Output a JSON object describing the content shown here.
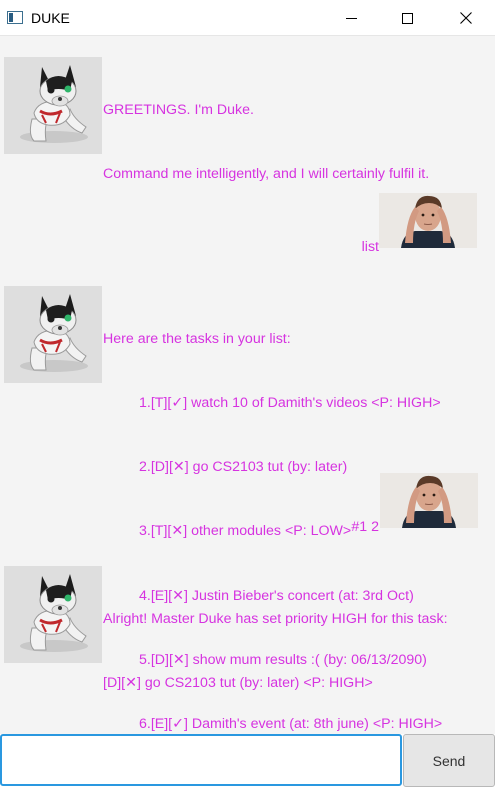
{
  "window": {
    "title": "DUKE",
    "icons": {
      "app": "app-window-icon",
      "minimize": "minimize-icon",
      "maximize": "maximize-icon",
      "close": "close-icon"
    }
  },
  "colors": {
    "message_text": "#d633e0",
    "input_focus_border": "#2a98e0"
  },
  "messages": [
    {
      "sender": "duke",
      "avatar": "robot-dog-avatar",
      "lines": [
        "GREETINGS. I'm Duke.",
        "Command me intelligently, and I will certainly fulfil it."
      ]
    },
    {
      "sender": "user",
      "avatar": "user-photo-avatar",
      "lines": [
        "list"
      ]
    },
    {
      "sender": "duke",
      "avatar": "robot-dog-avatar",
      "lines": [
        "Here are the tasks in your list:",
        "1.[T][✓] watch 10 of Damith's videos <P: HIGH>",
        "2.[D][✕] go CS2103 tut (by: later)",
        "3.[T][✕] other modules <P: LOW>",
        "4.[E][✕] Justin Bieber's concert (at: 3rd Oct)",
        "5.[D][✕] show mum results :( (by: 06/13/2090)",
        "6.[E][✓] Damith's event (at: 8th june) <P: HIGH>"
      ]
    },
    {
      "sender": "user",
      "avatar": "user-photo-avatar",
      "lines": [
        "#1 2"
      ]
    },
    {
      "sender": "duke",
      "avatar": "robot-dog-avatar",
      "lines": [
        "Alright! Master Duke has set priority HIGH for this task:",
        "[D][✕] go CS2103 tut (by: later) <P: HIGH>"
      ]
    }
  ],
  "input": {
    "value": "",
    "placeholder": ""
  },
  "send_button": {
    "label": "Send"
  }
}
